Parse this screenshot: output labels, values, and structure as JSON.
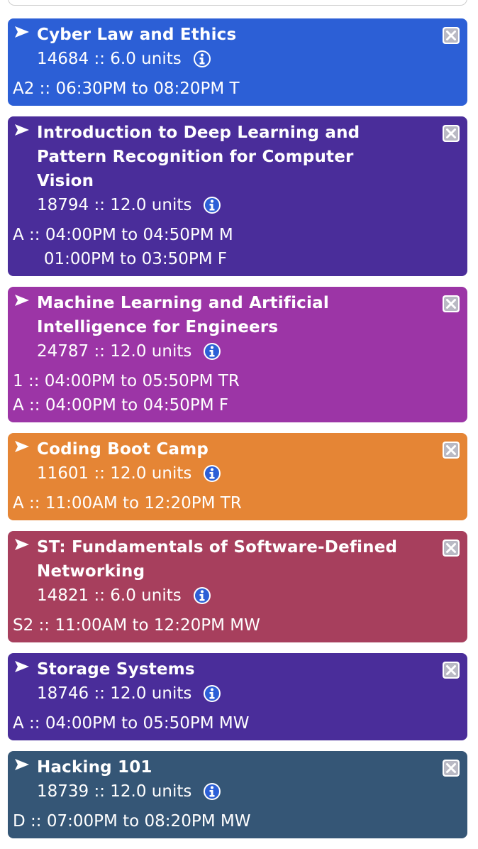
{
  "courses": [
    {
      "title": "Cyber Law and Ethics",
      "units": "14684 :: 6.0 units",
      "sections": [
        "A2 :: 06:30PM to 08:20PM T"
      ],
      "color": "#2c5fd6"
    },
    {
      "title": "Introduction to Deep Learning and Pattern Recognition for Computer Vision",
      "units": "18794 :: 12.0 units",
      "sections": [
        "A :: 04:00PM to 04:50PM M",
        "      01:00PM to 03:50PM F"
      ],
      "color": "#4a2d9a"
    },
    {
      "title": "Machine Learning and Artificial Intelligence for Engineers",
      "units": "24787 :: 12.0 units",
      "sections": [
        "1 :: 04:00PM to 05:50PM TR",
        "A :: 04:00PM to 04:50PM F"
      ],
      "color": "#9c35a6"
    },
    {
      "title": "Coding Boot Camp",
      "units": "11601 :: 12.0 units",
      "sections": [
        "A :: 11:00AM to 12:20PM TR"
      ],
      "color": "#e58535"
    },
    {
      "title": "ST: Fundamentals of Software-Defined Networking",
      "units": "14821 :: 6.0 units",
      "sections": [
        "S2 :: 11:00AM to 12:20PM MW"
      ],
      "color": "#a73f5d"
    },
    {
      "title": "Storage Systems",
      "units": "18746 :: 12.0 units",
      "sections": [
        "A :: 04:00PM to 05:50PM MW"
      ],
      "color": "#4a2d9a"
    },
    {
      "title": "Hacking 101",
      "units": "18739 :: 12.0 units",
      "sections": [
        "D :: 07:00PM to 08:20PM MW"
      ],
      "color": "#355676"
    }
  ],
  "icons": {
    "expand": "triangle-right-icon",
    "remove": "close-x-icon",
    "info": "info-icon"
  }
}
